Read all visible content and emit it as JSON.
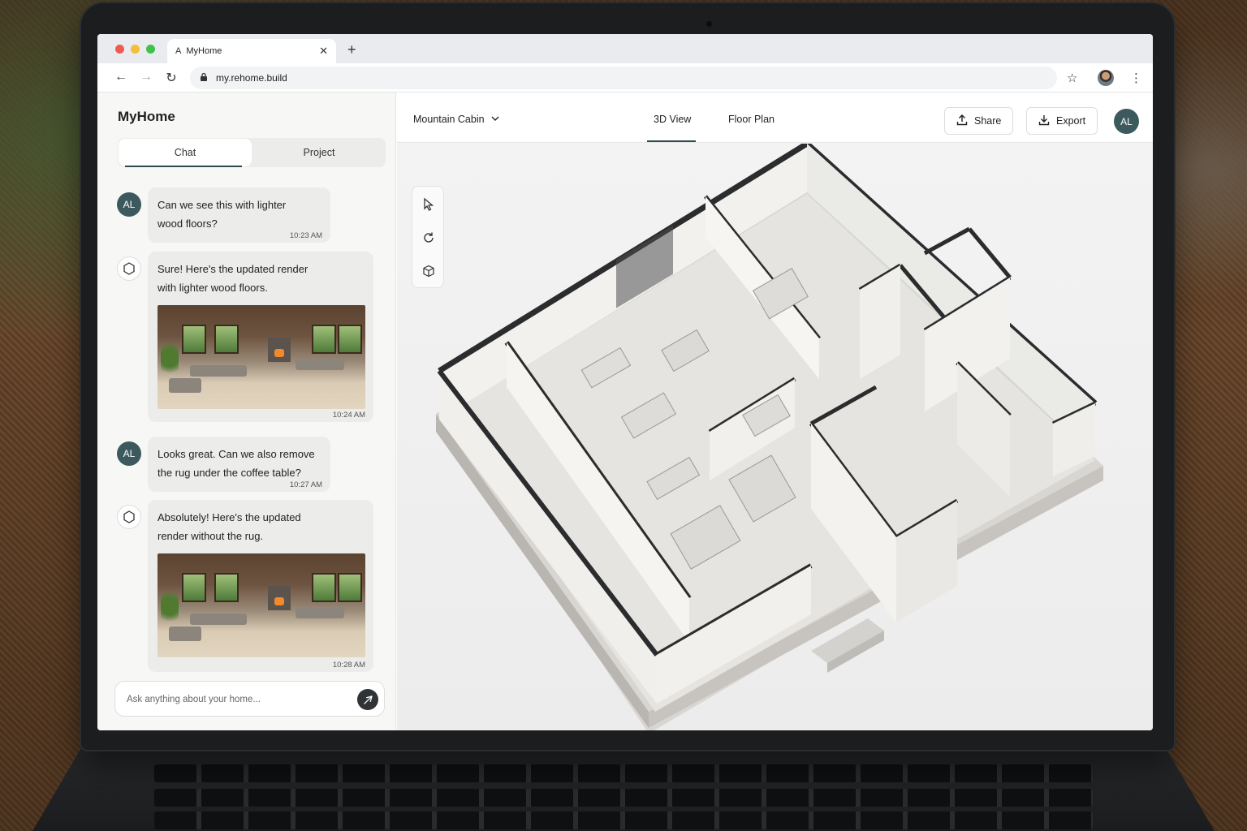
{
  "browser": {
    "tab_favicon": "A",
    "tab_title": "MyHome",
    "url": "my.rehome.build"
  },
  "sidebar": {
    "app_title": "MyHome",
    "tabs": [
      {
        "label": "Chat",
        "active": true
      },
      {
        "label": "Project",
        "active": false
      }
    ],
    "messages": [
      {
        "role": "user",
        "avatar": "AL",
        "text_line1": "Can we see this with lighter",
        "text_line2": "wood floors?",
        "time": "10:23 AM"
      },
      {
        "role": "assistant",
        "text_line1": "Sure! Here's the updated render",
        "text_line2": "with lighter wood floors.",
        "time": "10:24 AM",
        "has_image": true
      },
      {
        "role": "user",
        "avatar": "AL",
        "text_line1": "Looks great. Can we also remove",
        "text_line2": "the rug under the coffee table?",
        "time": "10:27 AM"
      },
      {
        "role": "assistant",
        "text_line1": "Absolutely! Here's the updated",
        "text_line2": "render without the rug.",
        "time": "10:28 AM",
        "has_image": true
      }
    ],
    "composer_placeholder": "Ask anything about your home..."
  },
  "main": {
    "project_name": "Mountain Cabin",
    "view_tabs": [
      {
        "label": "3D View",
        "active": true
      },
      {
        "label": "Floor Plan",
        "active": false
      }
    ],
    "share_label": "Share",
    "export_label": "Export",
    "user_avatar": "AL",
    "tools": [
      "cursor-icon",
      "rotate-icon",
      "cube-icon"
    ]
  },
  "colors": {
    "accent": "#2f4a4f",
    "avatar": "#3c5a5e"
  }
}
